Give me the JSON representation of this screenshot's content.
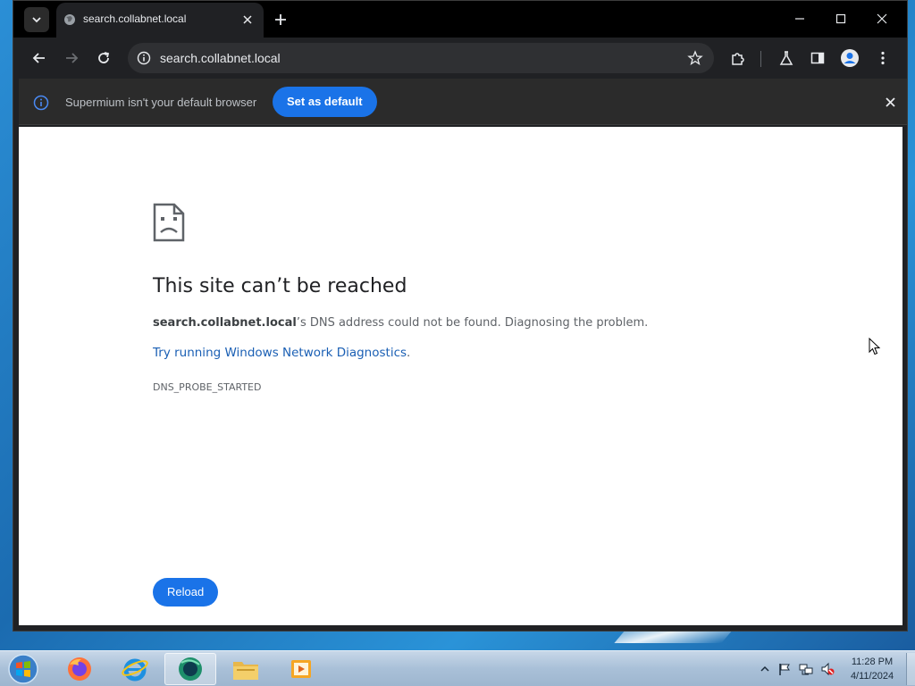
{
  "browser": {
    "tab_title": "search.collabnet.local",
    "url": "search.collabnet.local"
  },
  "infobar": {
    "message": "Supermium isn't your default browser",
    "button": "Set as default"
  },
  "error_page": {
    "heading": "This site can’t be reached",
    "host": "search.collabnet.local",
    "description_rest": "’s DNS address could not be found. Diagnosing the problem.",
    "link_text": "Try running Windows Network Diagnostics",
    "link_suffix": ".",
    "error_code": "DNS_PROBE_STARTED",
    "reload_button": "Reload"
  },
  "taskbar": {
    "apps": [
      "firefox-icon",
      "internet-explorer-icon",
      "supermium-icon",
      "file-explorer-icon",
      "media-player-icon"
    ],
    "clock_time": "11:28 PM",
    "clock_date": "4/11/2024"
  },
  "colors": {
    "accent": "#1a73e8",
    "link": "#1a5fb4",
    "chrome_bg": "#202124"
  }
}
